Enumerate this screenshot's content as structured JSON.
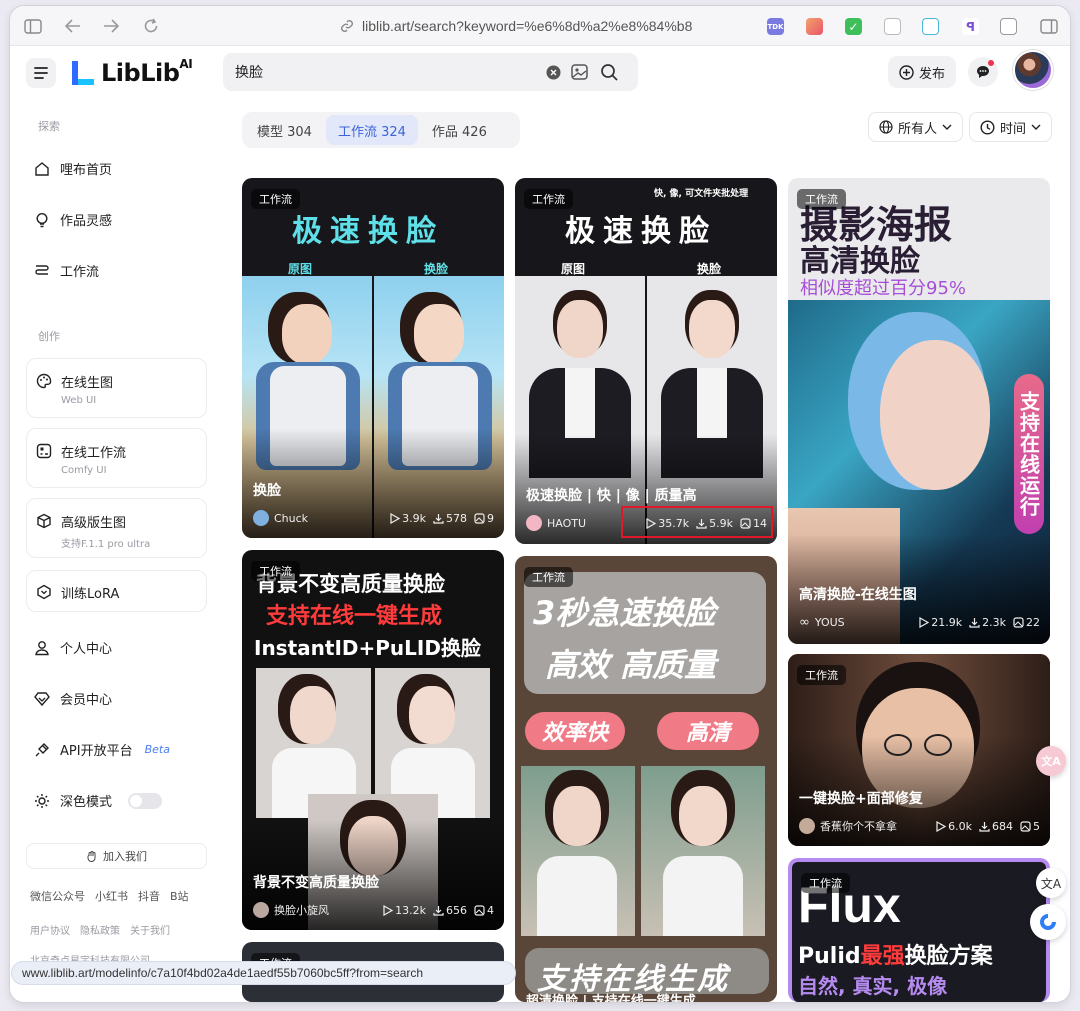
{
  "browser": {
    "url": "liblib.art/search?keyword=%e6%8d%a2%e8%84%b8",
    "ext_tdk": "TDK"
  },
  "header": {
    "logo": "LibLib",
    "logo_sup": "AI",
    "search_value": "换脸",
    "publish": "发布"
  },
  "sidebar": {
    "section_explore": "探索",
    "home": "哩布首页",
    "inspire": "作品灵感",
    "workflow": "工作流",
    "section_create": "创作",
    "online_gen": {
      "title": "在线生图",
      "sub": "Web UI"
    },
    "online_wf": {
      "title": "在线工作流",
      "sub": "Comfy UI"
    },
    "pro_gen": {
      "title": "高级版生图",
      "sub": "支持F.1.1 pro ultra"
    },
    "lora": "训练LoRA",
    "personal": "个人中心",
    "member": "会员中心",
    "api": "API开放平台",
    "api_beta": "Beta",
    "dark": "深色模式",
    "join": "加入我们",
    "links1": [
      "微信公众号",
      "小红书",
      "抖音",
      "B站"
    ],
    "links2": [
      "用户协议",
      "隐私政策",
      "关于我们"
    ],
    "company": "北京奇点星宇科技有限公司"
  },
  "status_url": "www.liblib.art/modelinfo/c7a10f4bd02a4de1aedf55b7060bc5ff?from=search",
  "tabs": [
    {
      "label": "模型 304"
    },
    {
      "label": "工作流 324",
      "active": true
    },
    {
      "label": "作品 426"
    }
  ],
  "filters": {
    "audience": "所有人",
    "sort": "时间"
  },
  "cards": [
    {
      "badge": "工作流",
      "big1": "极速换脸",
      "label_a": "原图",
      "label_b": "换脸",
      "title": "换脸",
      "author": "Chuck",
      "runs": "3.9k",
      "downloads": "578",
      "images": "9"
    },
    {
      "badge": "工作流",
      "corner": "快, 像, 可文件夹批处理",
      "big1": "极速换脸",
      "label_a": "原图",
      "label_b": "换脸",
      "title": "极速换脸 | 快 | 像 | 质量高",
      "author": "HAOTU",
      "runs": "35.7k",
      "downloads": "5.9k",
      "images": "14"
    },
    {
      "badge": "工作流",
      "big1": "摄影海报",
      "big2": "高清换脸",
      "big3": "相似度超过百分95%",
      "side": "支持在线运行",
      "title": "高清换脸-在线生图",
      "author": "YOUS",
      "runs": "21.9k",
      "downloads": "2.3k",
      "images": "22"
    },
    {
      "badge": "工作流",
      "big1": "背景不变高质量换脸",
      "big2": "支持在线一键生成",
      "big3": "InstantID+PuLID换脸",
      "title": "背景不变高质量换脸",
      "author": "换脸小旋风",
      "runs": "13.2k",
      "downloads": "656",
      "images": "4"
    },
    {
      "badge": "工作流",
      "big1": "3秒急速换脸",
      "big2": "高效 高质量",
      "pill1": "效率快",
      "pill2": "高清",
      "big3": "支持在线生成",
      "title": "超清换脸 | 支持在线一键生成"
    },
    {
      "badge": "工作流",
      "title": "一键换脸+面部修复",
      "author": "香蕉你个不拿拿",
      "runs": "6.0k",
      "downloads": "684",
      "images": "5"
    },
    {
      "badge": "工作流",
      "big1": "Flux",
      "big2a": "Pulid",
      "big2b": "最强",
      "big2c": "换脸方案",
      "big3": "自然, 真实, 极像"
    },
    {
      "badge": "工作流"
    }
  ],
  "colors": {
    "accent": "#3b64d8",
    "highlight": "#e0192a",
    "teal": "#5fe0e8",
    "pink": "#e86a8a",
    "purple": "#a64fd6"
  }
}
